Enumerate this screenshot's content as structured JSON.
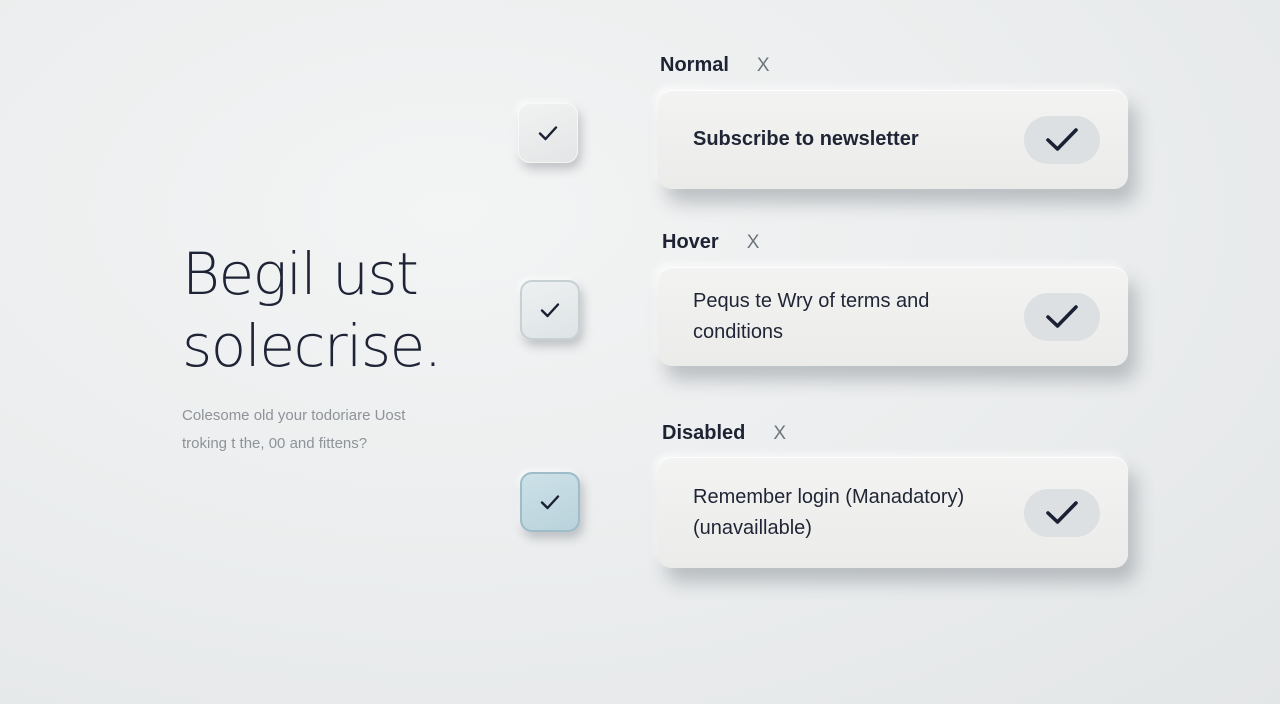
{
  "hero": {
    "title": "Begil ust\nsolecrise.",
    "description": "Colesome old your todoriare Uost\ntroking t the, 00 and fittens?"
  },
  "states": [
    {
      "label": "Normal",
      "close": "X",
      "option_text": "Subscribe to newsletter",
      "checked": true
    },
    {
      "label": "Hover",
      "close": "X",
      "option_text": "Pequs te Wry of terms and conditions",
      "checked": true
    },
    {
      "label": "Disabled",
      "close": "X",
      "option_text": "Remember login (Manadatory)\n(unavaillable)",
      "checked": true
    }
  ],
  "colors": {
    "text": "#1d2333",
    "check": "#1b2134",
    "disabled_checkbox": "#c3d9e1"
  },
  "icons": {
    "checkbox_mark": "check-icon",
    "card_mark": "check-icon",
    "label_close": "x-icon"
  }
}
